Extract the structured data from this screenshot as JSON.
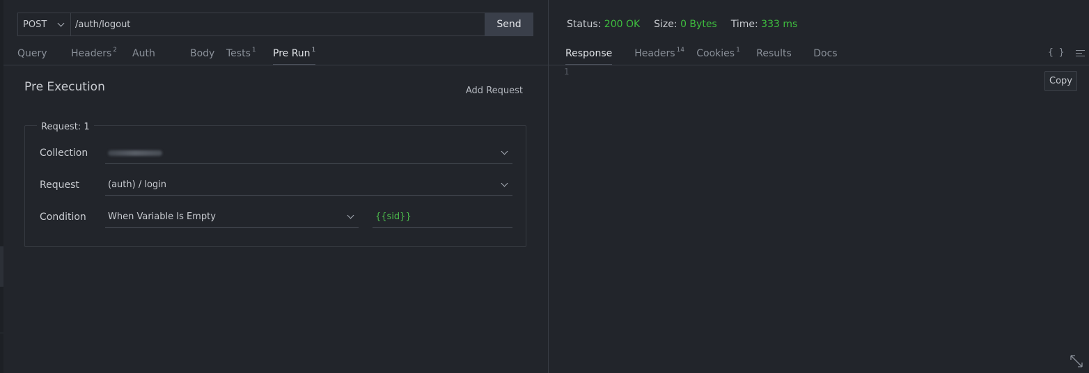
{
  "request": {
    "method": "POST",
    "url": "/auth/logout",
    "send_label": "Send"
  },
  "request_tabs": [
    {
      "label": "Query",
      "count": ""
    },
    {
      "label": "Headers",
      "count": "2"
    },
    {
      "label": "Auth",
      "count": ""
    },
    {
      "label": "Body",
      "count": ""
    },
    {
      "label": "Tests",
      "count": "1"
    },
    {
      "label": "Pre Run",
      "count": "1",
      "active": true
    }
  ],
  "pre_run": {
    "title": "Pre Execution",
    "add_request_label": "Add Request",
    "block": {
      "legend": "Request: 1",
      "collection_label": "Collection",
      "request_label": "Request",
      "request_value": "(auth) / login",
      "condition_label": "Condition",
      "condition_value": "When Variable Is Empty",
      "variable_value": "{{sid}}"
    }
  },
  "response": {
    "status_label": "Status:",
    "status_value": "200 OK",
    "size_label": "Size:",
    "size_value": "0 Bytes",
    "time_label": "Time:",
    "time_value": "333 ms",
    "line_number": "1",
    "copy_label": "Copy",
    "format_icon": "{ }"
  },
  "response_tabs": [
    {
      "label": "Response",
      "count": "",
      "active": true
    },
    {
      "label": "Headers",
      "count": "14"
    },
    {
      "label": "Cookies",
      "count": "1"
    },
    {
      "label": "Results",
      "count": ""
    },
    {
      "label": "Docs",
      "count": ""
    }
  ],
  "colors": {
    "background": "#22252b",
    "success": "#3fbf3f",
    "variable": "#4cbb4c"
  }
}
